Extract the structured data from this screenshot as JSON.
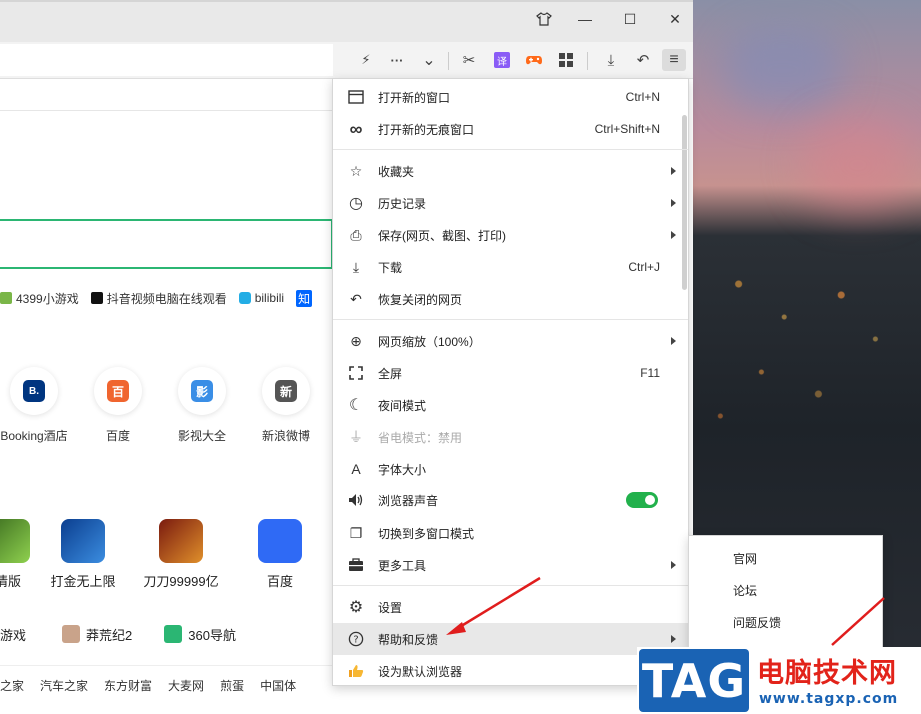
{
  "window": {
    "skin_icon": "shirt-icon",
    "minimize_glyph": "—",
    "maximize_glyph": "☐",
    "close_glyph": "✕"
  },
  "toolbar": {
    "lightning_glyph": "⚡",
    "more_glyph": "···",
    "dropdown_glyph": "⌄",
    "cut_glyph": "✂",
    "translate_label": "译",
    "download_glyph": "⤓",
    "undo_glyph": "↶",
    "menu_glyph": "≡"
  },
  "quick_links": [
    {
      "label": "4399小游戏",
      "color": "#7ab648"
    },
    {
      "label": "抖音视频电脑在线观看",
      "color": "#111111"
    },
    {
      "label": "bilibili",
      "color": "#23ade5"
    },
    {
      "label": "知",
      "color": "#0066ff"
    }
  ],
  "site_tiles": [
    {
      "label": "Booking酒店",
      "glyph": "B.",
      "color": "#003580"
    },
    {
      "label": "百度",
      "glyph": "百",
      "color": "#f0652f"
    },
    {
      "label": "影视大全",
      "glyph": "影",
      "color": "#3a8ee6"
    },
    {
      "label": "新浪微博",
      "glyph": "新",
      "color": "#555555"
    }
  ],
  "game_tiles": [
    {
      "label": "情版"
    },
    {
      "label": "打金无上限"
    },
    {
      "label": "刀刀99999亿"
    },
    {
      "label": "百度"
    }
  ],
  "row_links": [
    "游戏",
    "莽荒纪2",
    "360导航"
  ],
  "bottom_links": [
    "之家",
    "汽车之家",
    "东方财富",
    "大麦网",
    "煎蛋",
    "中国体"
  ],
  "menu": {
    "items": [
      {
        "label": "打开新的窗口",
        "shortcut": "Ctrl+N",
        "icon": "new-window-icon",
        "glyph": "▭"
      },
      {
        "label": "打开新的无痕窗口",
        "shortcut": "Ctrl+Shift+N",
        "icon": "incognito-icon",
        "glyph": "∞"
      },
      {
        "label": "收藏夹",
        "icon": "star-list-icon",
        "glyph": "☆"
      },
      {
        "label": "历史记录",
        "icon": "clock-icon",
        "glyph": "◷"
      },
      {
        "label": "保存(网页、截图、打印)",
        "icon": "save-icon",
        "glyph": "⎙"
      },
      {
        "label": "下载",
        "shortcut": "Ctrl+J",
        "icon": "download-icon",
        "glyph": "⤓"
      },
      {
        "label": "恢复关闭的网页",
        "icon": "restore-icon",
        "glyph": "↶"
      },
      {
        "label": "网页缩放（100%）",
        "icon": "zoom-icon",
        "glyph": "⊕"
      },
      {
        "label": "全屏",
        "shortcut": "F11",
        "icon": "fullscreen-icon",
        "glyph": "⛶"
      },
      {
        "label": "夜间模式",
        "icon": "moon-icon",
        "glyph": "☾"
      },
      {
        "label": "省电模式：禁用",
        "icon": "plug-icon",
        "glyph": "⏚"
      },
      {
        "label": "字体大小",
        "icon": "font-size-icon",
        "glyph": "A"
      },
      {
        "label": "浏览器声音",
        "icon": "speaker-icon",
        "glyph": "🔈"
      },
      {
        "label": "切换到多窗口模式",
        "icon": "multi-window-icon",
        "glyph": "❐"
      },
      {
        "label": "更多工具",
        "icon": "toolbox-icon",
        "glyph": "▬"
      },
      {
        "label": "设置",
        "icon": "gear-icon",
        "glyph": "⚙"
      },
      {
        "label": "帮助和反馈",
        "icon": "help-icon",
        "glyph": "?"
      },
      {
        "label": "设为默认浏览器",
        "icon": "thumbs-up-icon",
        "glyph": "👍"
      }
    ],
    "sound_enabled": true
  },
  "submenu": {
    "items": [
      "官网",
      "论坛",
      "问题反馈"
    ]
  },
  "watermark": {
    "logo_text": "TAG",
    "title": "电脑技术网",
    "url": "www.tagxp.com"
  },
  "colors": {
    "accent_green": "#22b14c",
    "arrow_red": "#e01d1d",
    "watermark_blue": "#1a63b4",
    "watermark_red": "#e2231a"
  }
}
